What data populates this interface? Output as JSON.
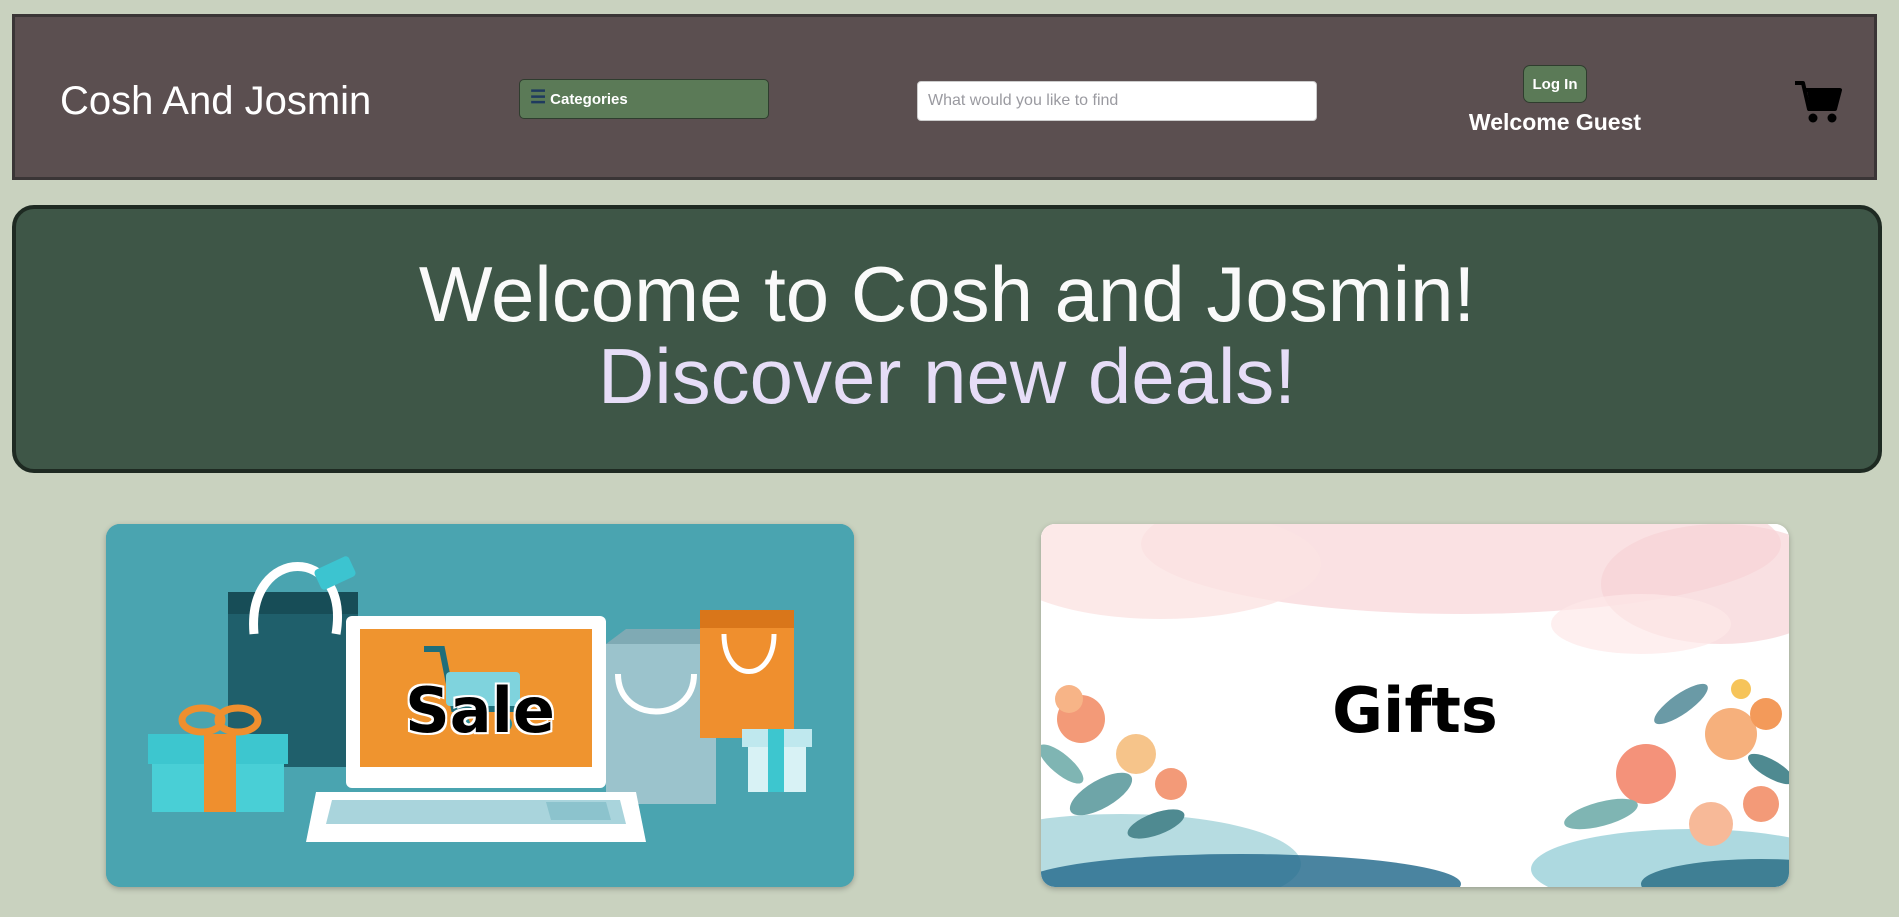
{
  "header": {
    "brand": "Cosh And Josmin",
    "categories_label": "Categories",
    "search_placeholder": "What would you like to find",
    "login_label": "Log In",
    "welcome_text": "Welcome Guest",
    "cart_icon": "shopping-cart-icon"
  },
  "hero": {
    "line1": "Welcome to Cosh and Josmin!",
    "line2": "Discover new deals!"
  },
  "cards": [
    {
      "label": "Sale"
    },
    {
      "label": "Gifts"
    }
  ],
  "colors": {
    "page_bg": "#c9d2bf",
    "header_bg": "#5b4f50",
    "button_green": "#5b7a57",
    "hero_bg": "#3e5647",
    "hero_line2": "#e6ddf7"
  }
}
